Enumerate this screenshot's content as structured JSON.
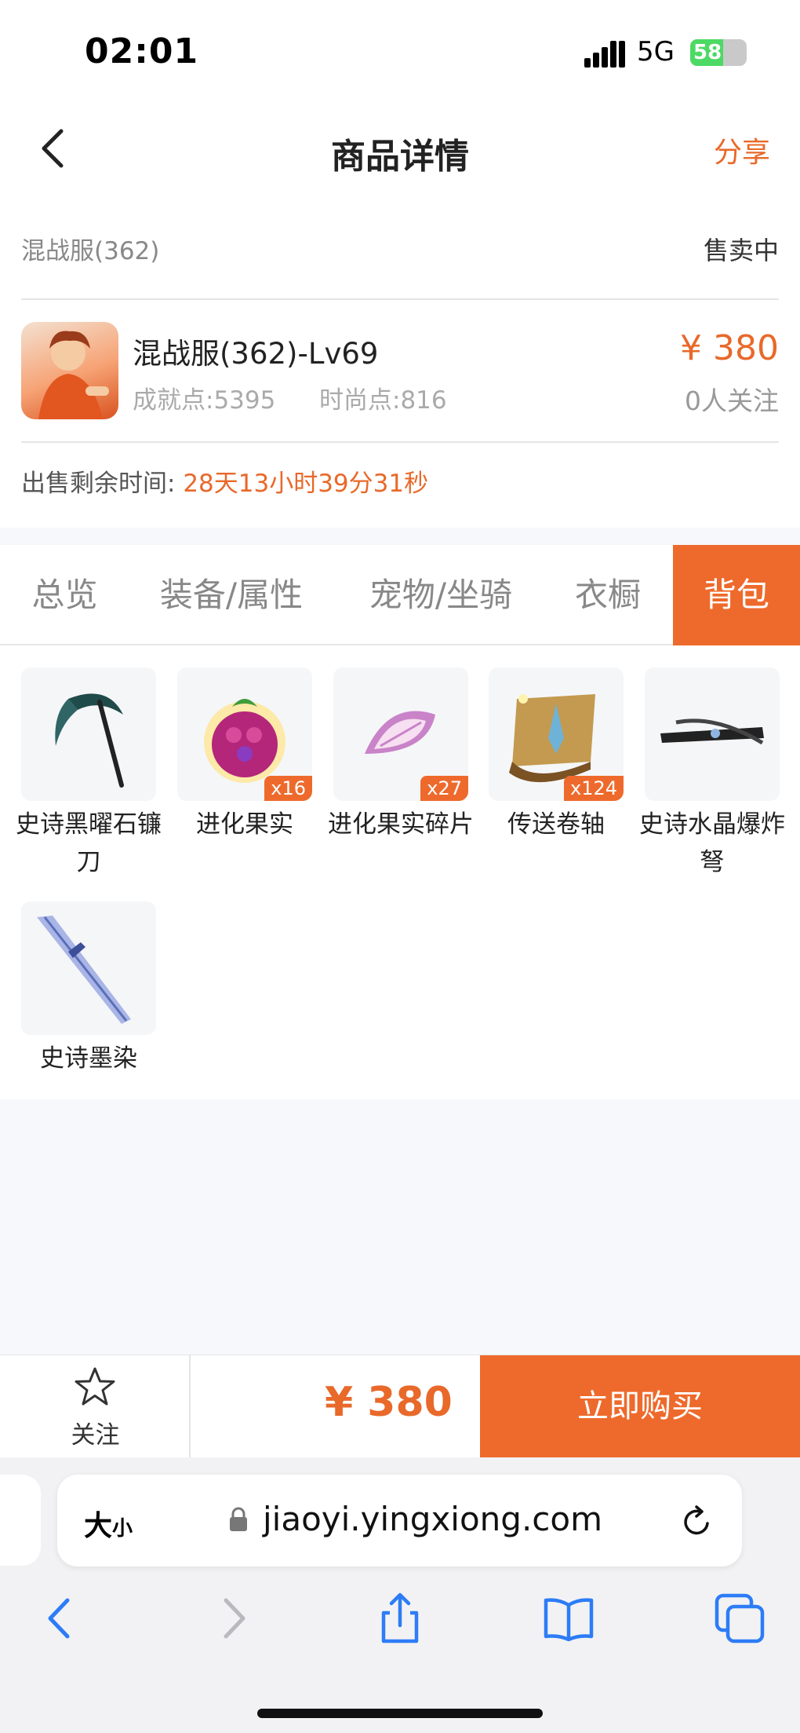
{
  "status_bar": {
    "time": "02:01",
    "network": "5G",
    "battery": "58",
    "battery_level": 0.58
  },
  "header": {
    "title": "商品详情",
    "share": "分享"
  },
  "server": {
    "name": "混战服(362)",
    "status": "售卖中"
  },
  "product": {
    "name": "混战服(362)-Lv69",
    "achievement": "成就点:5395",
    "fashion": "时尚点:816",
    "price": "¥ 380",
    "followers": "0人关注"
  },
  "sale_time": {
    "label": "出售剩余时间:",
    "value": "28天13小时39分31秒"
  },
  "tabs": [
    {
      "label": "总览"
    },
    {
      "label": "装备/属性"
    },
    {
      "label": "宠物/坐骑"
    },
    {
      "label": "衣橱"
    },
    {
      "label": "背包"
    }
  ],
  "active_tab": "背包",
  "items": [
    {
      "label": "史诗黑曜石镰刀",
      "qty": ""
    },
    {
      "label": "进化果实",
      "qty": "x16"
    },
    {
      "label": "进化果实碎片",
      "qty": "x27"
    },
    {
      "label": "传送卷轴",
      "qty": "x124"
    },
    {
      "label": "史诗水晶爆炸弩",
      "qty": ""
    },
    {
      "label": "史诗墨染",
      "qty": ""
    }
  ],
  "bottom_bar": {
    "follow": "关注",
    "price": "¥ 380",
    "buy": "立即购买"
  },
  "safari": {
    "text_size": "大",
    "text_size_small": "小",
    "url": "jiaoyi.yingxiong.com"
  },
  "colors": {
    "accent": "#ee6a2c",
    "price": "#e8692a",
    "ios_blue": "#2d7cf6"
  }
}
